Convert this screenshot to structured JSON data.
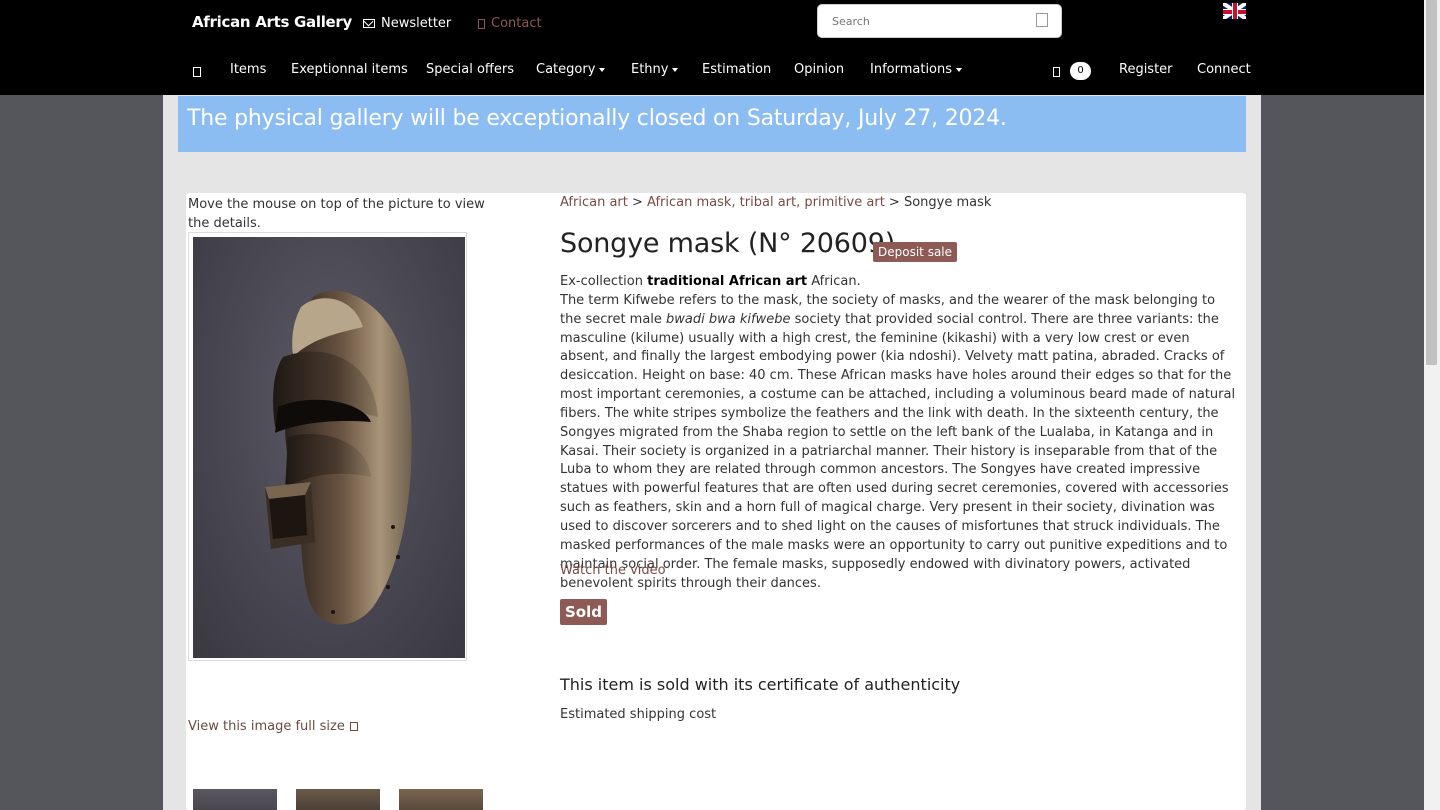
{
  "header": {
    "brand": "African Arts Gallery",
    "newsletter": "Newsletter",
    "contact": "Contact",
    "search_placeholder": "Search",
    "cart_count": "0",
    "language_flag": "uk-flag-icon"
  },
  "nav": {
    "items": "Items",
    "exceptional": "Exeptionnal items",
    "special_offers": "Special offers",
    "category": "Category",
    "ethny": "Ethny",
    "estimation": "Estimation",
    "opinion": "Opinion",
    "informations": "Informations",
    "register": "Register",
    "connect": "Connect"
  },
  "banner": {
    "text": "The physical gallery will be exceptionally closed on Saturday, July 27, 2024."
  },
  "gallery": {
    "hint": "Move the mouse on top of the picture to view the details.",
    "view_full": "View this image full size"
  },
  "product": {
    "breadcrumb": {
      "crumb1": "African art",
      "sep1": " > ",
      "crumb2": "African mask, tribal art, primitive art",
      "sep2": " > ",
      "current": "Songye mask"
    },
    "title": "Songye mask (N° 20609)",
    "deposit_badge": "Deposit sale",
    "desc_prefix": "Ex-collection ",
    "desc_bold": "traditional African art",
    "desc_suffix": " African.",
    "desc_p1": "The term Kifwebe refers to the mask, the society of masks, and the wearer of the mask belonging to the secret male ",
    "desc_italic": "bwadi bwa kifwebe",
    "desc_p2": " society that provided social control. There are three variants: the masculine (kilume) usually with a high crest, the feminine (kikashi) with a very low crest or even absent, and finally the largest embodying power (kia ndoshi). Velvety matt patina, abraded. Cracks of desiccation. Height on base: 40 cm. These African masks have holes around their edges so that for the most important ceremonies, a costume can be attached, including a voluminous beard made of natural fibers. The white stripes symbolize the feathers and the link with death. In the sixteenth century, the Songyes migrated from the Shaba region to settle on the left bank of the Lualaba, in Katanga and in Kasai. Their society is organized in a patriarchal manner. Their history is inseparable from that of the Luba to whom they are related through common ancestors. The Songyes have created impressive statues with powerful features that are often used during secret ceremonies, covered with accessories such as feathers, skin and a horn full of magical charge. Very present in their society, divination was used to discover sorcerers and to shed light on the causes of misfortunes that struck individuals. The masked performances of the male masks were an opportunity to carry out punitive expeditions and to maintain social order. The female masks, supposedly endowed with divinatory powers, activated benevolent spirits through their dances.",
    "video_link": "Watch the video",
    "sold_badge": "Sold",
    "certificate": "This item is sold with its certificate of authenticity",
    "shipping": "Estimated shipping cost"
  },
  "colors": {
    "banner_bg": "#8bbcf2",
    "badge_bg": "#8d5a55",
    "link": "#7a4b44",
    "topbar": "#000000"
  }
}
